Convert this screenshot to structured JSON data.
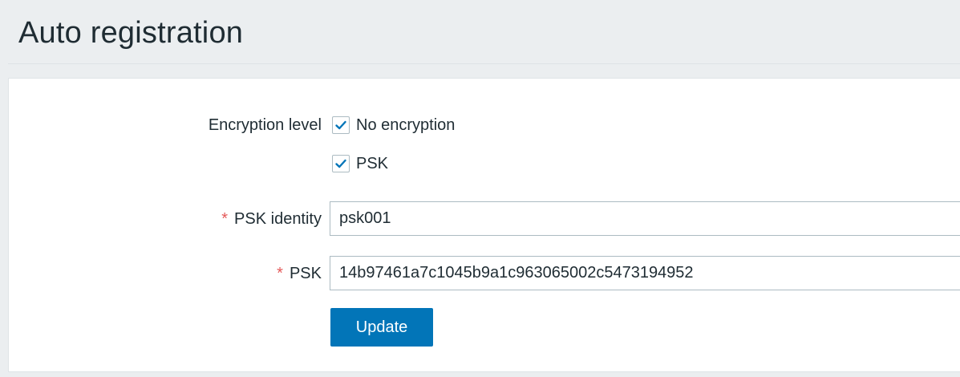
{
  "header": {
    "title": "Auto registration"
  },
  "form": {
    "encryption_level": {
      "label": "Encryption level",
      "options": [
        {
          "label": "No encryption",
          "checked": true
        },
        {
          "label": "PSK",
          "checked": true
        }
      ]
    },
    "psk_identity": {
      "required_marker": "*",
      "label": "PSK identity",
      "value": "psk001"
    },
    "psk": {
      "required_marker": "*",
      "label": "PSK",
      "value": "14b97461a7c1045b9a1c963065002c5473194952"
    },
    "update_label": "Update"
  },
  "colors": {
    "accent": "#0275b8",
    "required": "#e45959",
    "background": "#ebeef0",
    "text": "#1f2c33"
  },
  "icons": {
    "checkbox_check": "check-icon"
  }
}
